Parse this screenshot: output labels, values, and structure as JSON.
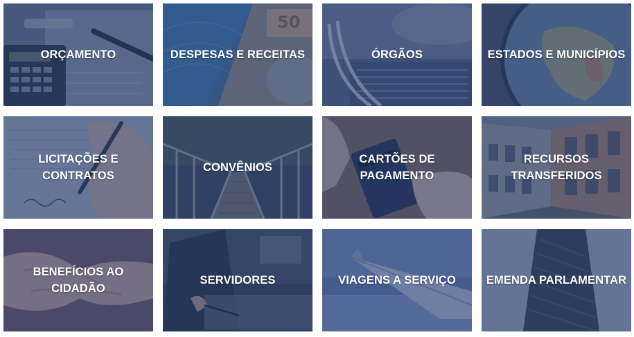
{
  "tiles": [
    {
      "label": "ORÇAMENTO",
      "image": "calculator-pen-icon"
    },
    {
      "label": "DESPESAS E RECEITAS",
      "image": "banknotes-icon"
    },
    {
      "label": "ÓRGÃOS",
      "image": "government-building-icon"
    },
    {
      "label": "ESTADOS E MUNICÍPIOS",
      "image": "globe-icon"
    },
    {
      "label": "LICITAÇÕES E\nCONTRATOS",
      "image": "signing-document-icon"
    },
    {
      "label": "CONVÊNIOS",
      "image": "bridge-icon"
    },
    {
      "label": "CARTÕES DE\nPAGAMENTO",
      "image": "payment-card-icon"
    },
    {
      "label": "RECURSOS\nTRANSFERIDOS",
      "image": "street-buildings-icon"
    },
    {
      "label": "BENEFÍCIOS AO\nCIDADÃO",
      "image": "joined-hands-icon"
    },
    {
      "label": "SERVIDORES",
      "image": "office-worker-icon"
    },
    {
      "label": "VIAGENS A SERVIÇO",
      "image": "airplane-wing-icon"
    },
    {
      "label": "EMENDA PARLAMENTAR",
      "image": "necktie-icon"
    }
  ],
  "colors": {
    "overlay": "#243a6e",
    "label": "#ffffff"
  }
}
